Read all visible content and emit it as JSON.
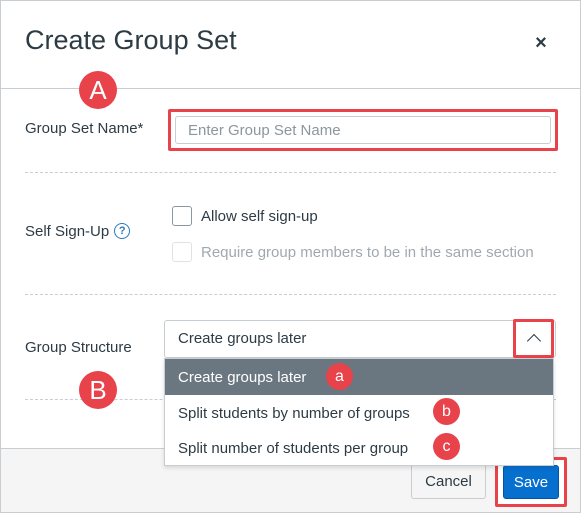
{
  "dialog": {
    "title": "Create Group Set",
    "close_symbol": "×"
  },
  "group_set_name": {
    "label": "Group Set Name*",
    "placeholder": "Enter Group Set Name",
    "value": ""
  },
  "self_signup": {
    "label": "Self Sign-Up",
    "help_symbol": "?",
    "options": [
      {
        "label": "Allow self sign-up",
        "checked": false,
        "disabled": false
      },
      {
        "label": "Require group members to be in the same section",
        "checked": false,
        "disabled": true
      }
    ]
  },
  "group_structure": {
    "label": "Group Structure",
    "selected": "Create groups later",
    "options": [
      {
        "label": "Create groups later",
        "selected": true
      },
      {
        "label": "Split students by number of groups",
        "selected": false
      },
      {
        "label": "Split number of students per group",
        "selected": false
      }
    ]
  },
  "footer": {
    "cancel_label": "Cancel",
    "save_label": "Save"
  },
  "annotations": {
    "markers": [
      "A",
      "B"
    ],
    "option_markers": [
      "a",
      "b",
      "c"
    ],
    "highlight_color": "#e8424a"
  },
  "colors": {
    "primary_button": "#0770cf",
    "selected_option": "#6b7780",
    "text": "#2d3b45"
  }
}
